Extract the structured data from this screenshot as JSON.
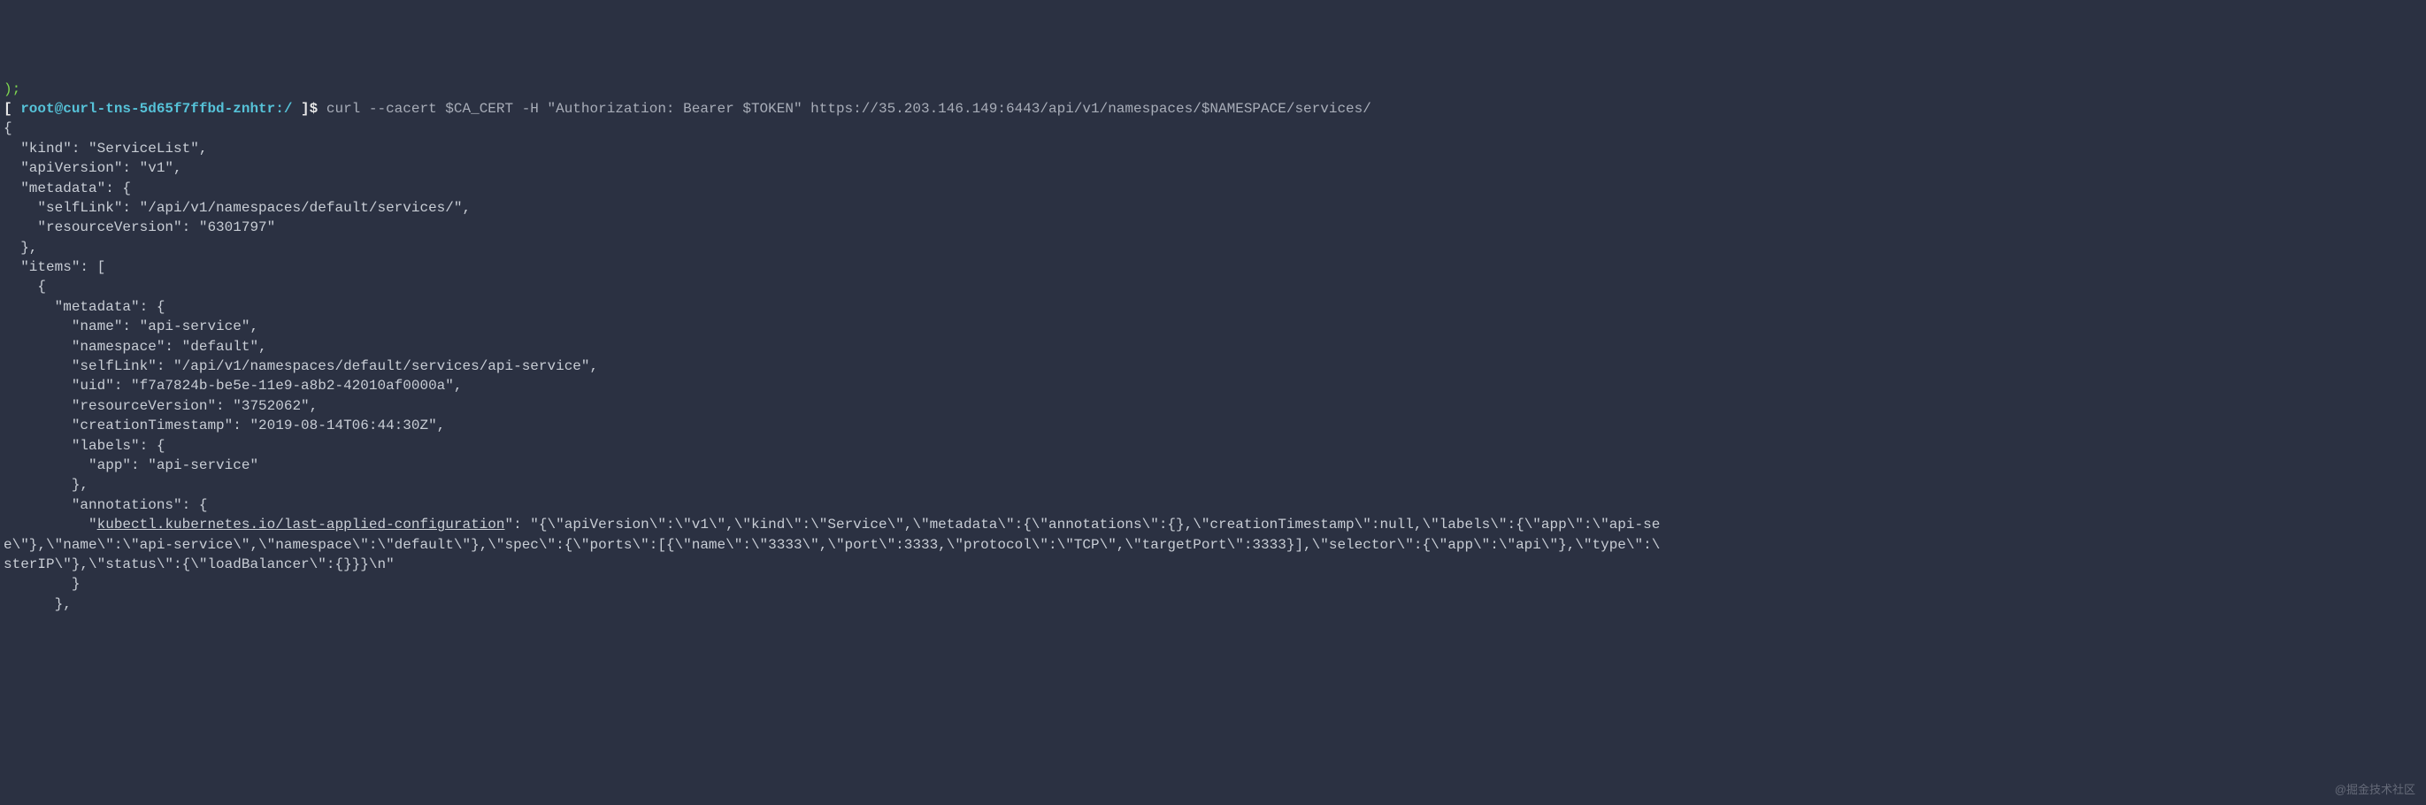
{
  "top_trail": ");",
  "prompt_open": "[ ",
  "prompt_user": "root@curl-tns-5d65f7ffbd-znhtr:/",
  "prompt_close": " ]$ ",
  "command": "curl --cacert $CA_CERT -H \"Authorization: Bearer $TOKEN\" https://35.203.146.149:6443/api/v1/namespaces/$NAMESPACE/services/",
  "json_lines": {
    "l00": "{",
    "l01": "  \"kind\": \"ServiceList\",",
    "l02": "  \"apiVersion\": \"v1\",",
    "l03": "  \"metadata\": {",
    "l04": "    \"selfLink\": \"/api/v1/namespaces/default/services/\",",
    "l05": "    \"resourceVersion\": \"6301797\"",
    "l06": "  },",
    "l07": "  \"items\": [",
    "l08": "    {",
    "l09": "      \"metadata\": {",
    "l10": "        \"name\": \"api-service\",",
    "l11": "        \"namespace\": \"default\",",
    "l12": "        \"selfLink\": \"/api/v1/namespaces/default/services/api-service\",",
    "l13": "        \"uid\": \"f7a7824b-be5e-11e9-a8b2-42010af0000a\",",
    "l14": "        \"resourceVersion\": \"3752062\",",
    "l15": "        \"creationTimestamp\": \"2019-08-14T06:44:30Z\",",
    "l16": "        \"labels\": {",
    "l17": "          \"app\": \"api-service\"",
    "l18": "        },",
    "l19": "        \"annotations\": {",
    "l20_prefix": "          \"",
    "l20_link": "kubectl.kubernetes.io/last-applied-configuration",
    "l20_suffix": "\": \"{\\\"apiVersion\\\":\\\"v1\\\",\\\"kind\\\":\\\"Service\\\",\\\"metadata\\\":{\\\"annotations\\\":{},\\\"creationTimestamp\\\":null,\\\"labels\\\":{\\\"app\\\":\\\"api-se",
    "l21": "e\\\"},\\\"name\\\":\\\"api-service\\\",\\\"namespace\\\":\\\"default\\\"},\\\"spec\\\":{\\\"ports\\\":[{\\\"name\\\":\\\"3333\\\",\\\"port\\\":3333,\\\"protocol\\\":\\\"TCP\\\",\\\"targetPort\\\":3333}],\\\"selector\\\":{\\\"app\\\":\\\"api\\\"},\\\"type\\\":\\",
    "l22": "sterIP\\\"},\\\"status\\\":{\\\"loadBalancer\\\":{}}}\\n\"",
    "l23": "        }",
    "l24": "      },"
  },
  "watermark": "@掘金技术社区"
}
